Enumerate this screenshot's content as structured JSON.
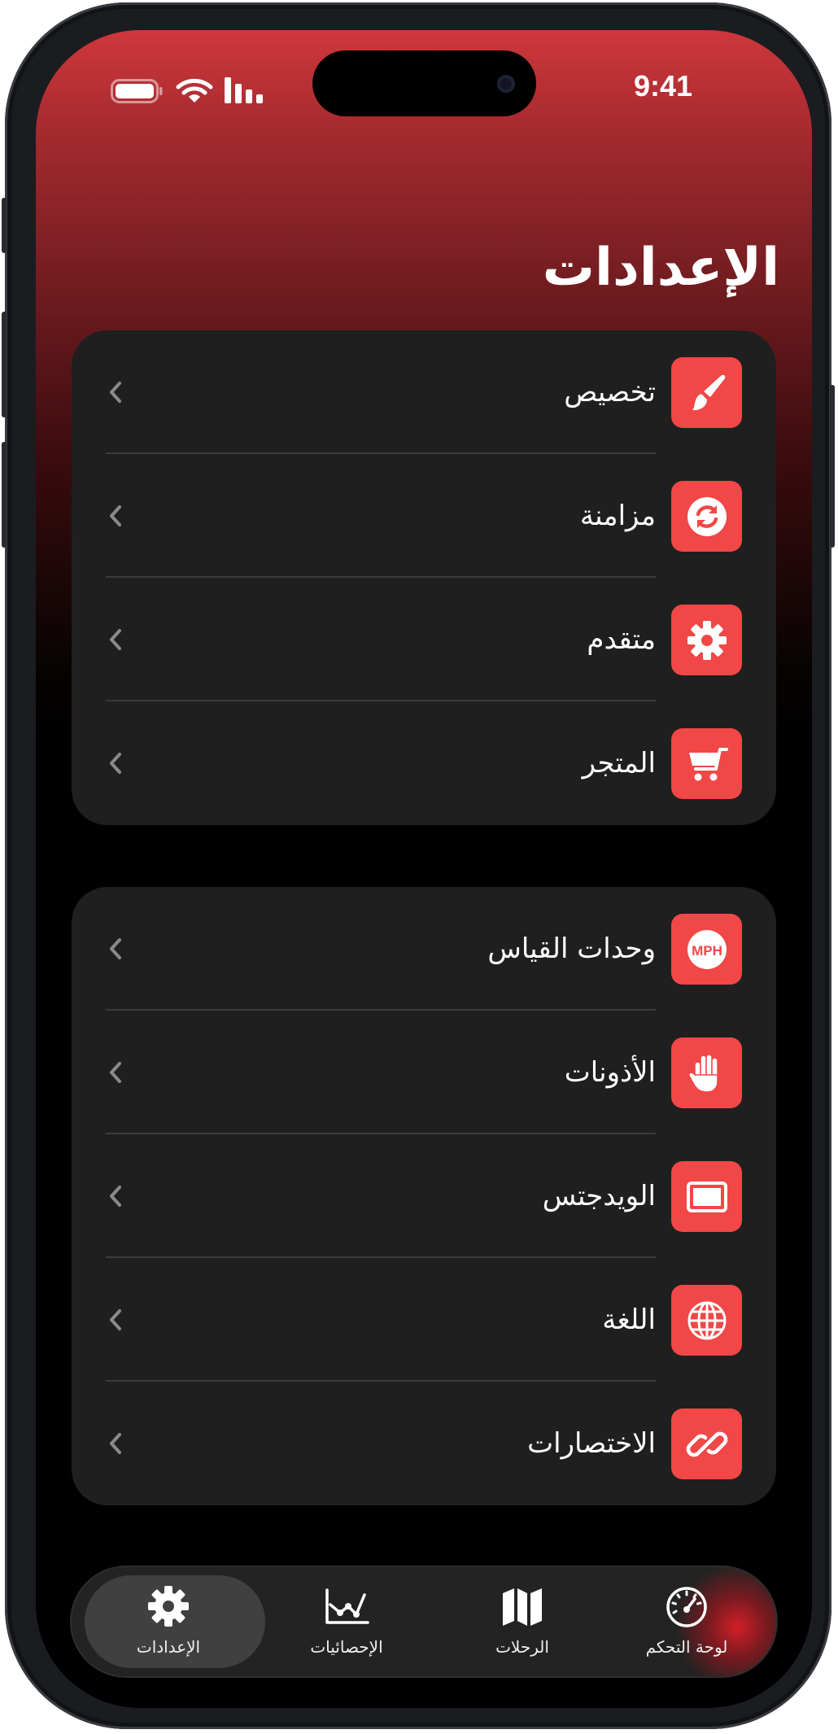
{
  "status_bar": {
    "time": "9:41"
  },
  "page_title": "الإعدادات",
  "colors": {
    "accent": "#f24747",
    "card": "#1f1f1f",
    "header_red": "#cf373b"
  },
  "groups": [
    {
      "items": [
        {
          "label": "تخصيص",
          "icon": "paintbrush-icon"
        },
        {
          "label": "مزامنة",
          "icon": "sync-icon"
        },
        {
          "label": "متقدم",
          "icon": "gear-icon"
        },
        {
          "label": "المتجر",
          "icon": "cart-icon"
        }
      ]
    },
    {
      "items": [
        {
          "label": "وحدات القياس",
          "icon": "mph-icon",
          "icon_text": "MPH"
        },
        {
          "label": "الأذونات",
          "icon": "hand-icon"
        },
        {
          "label": "الويدجتس",
          "icon": "widget-icon"
        },
        {
          "label": "اللغة",
          "icon": "globe-icon"
        },
        {
          "label": "الاختصارات",
          "icon": "link-icon"
        }
      ]
    }
  ],
  "tab_bar": {
    "tabs": [
      {
        "label": "الإعدادات",
        "icon": "gear-icon",
        "active": true
      },
      {
        "label": "الإحصائيات",
        "icon": "chart-icon",
        "active": false
      },
      {
        "label": "الرحلات",
        "icon": "map-icon",
        "active": false
      },
      {
        "label": "لوحة التحكم",
        "icon": "speedometer-icon",
        "active": false
      }
    ]
  }
}
